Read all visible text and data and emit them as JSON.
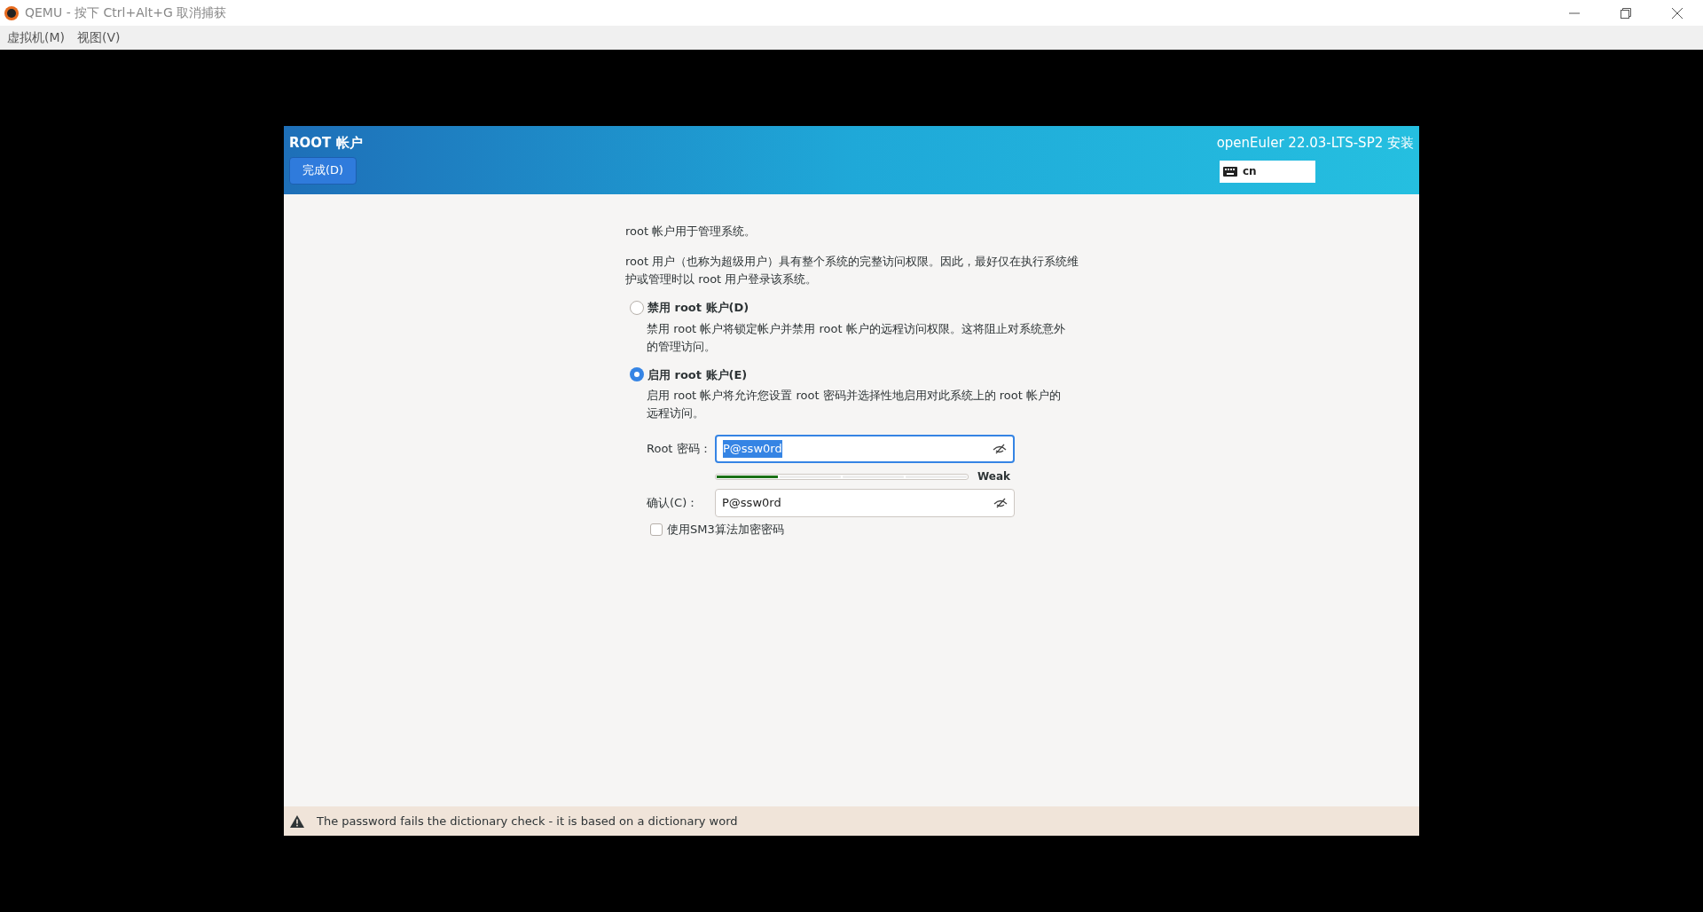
{
  "window": {
    "title": "QEMU - 按下 Ctrl+Alt+G 取消捕获"
  },
  "menu": [
    {
      "label": "虚拟机(M)"
    },
    {
      "label": "视图(V)"
    }
  ],
  "installer": {
    "page_title": "ROOT 帐户",
    "done_button": "完成(D)",
    "product": "openEuler 22.03-LTS-SP2 安装",
    "keyboard_layout": "cn"
  },
  "intro": [
    "root 帐户用于管理系统。",
    "root 用户（也称为超级用户）具有整个系统的完整访问权限。因此，最好仅在执行系统维护或管理时以 root 用户登录该系统。"
  ],
  "options": [
    {
      "label": "禁用 root 账户(D)",
      "description": "禁用 root 帐户将锁定帐户并禁用 root 帐户的远程访问权限。这将阻止对系统意外的管理访问。",
      "selected": false
    },
    {
      "label": "启用 root 账户(E)",
      "description": "启用 root 帐户将允许您设置 root 密码并选择性地启用对此系统上的 root 帐户的远程访问。",
      "selected": true
    }
  ],
  "password": {
    "label": "Root 密码：",
    "value": "P@ssw0rd",
    "text_selected": true,
    "focused": true
  },
  "strength": {
    "level": 0.25,
    "reading": "Weak"
  },
  "confirm": {
    "label": "确认(C)：",
    "value": "P@ssw0rd",
    "text_selected": false,
    "focused": false
  },
  "sm3": {
    "label": "使用SM3算法加密密码",
    "checked": false
  },
  "warning": "The password fails the dictionary check - it is based on a dictionary word"
}
